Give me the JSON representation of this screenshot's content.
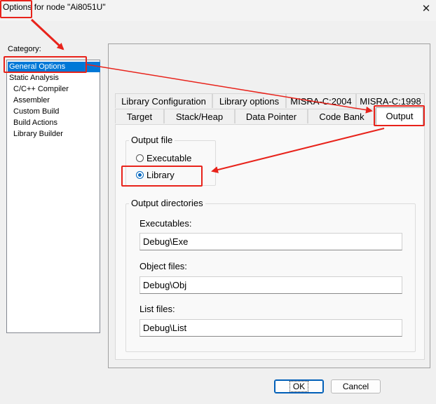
{
  "window": {
    "title": "Options for node \"Ai8051U\""
  },
  "category": {
    "label": "Category:",
    "items": [
      {
        "label": "General Options",
        "selected": true
      },
      {
        "label": "Static Analysis"
      },
      {
        "label": "C/C++ Compiler"
      },
      {
        "label": "Assembler"
      },
      {
        "label": "Custom Build"
      },
      {
        "label": "Build Actions"
      },
      {
        "label": "Library Builder"
      }
    ]
  },
  "tabs": {
    "row_top": [
      "Library Configuration",
      "Library options",
      "MISRA-C:2004",
      "MISRA-C:1998"
    ],
    "row_bottom": [
      "Target",
      "Stack/Heap",
      "Data Pointer",
      "Code Bank",
      "Output"
    ],
    "active": "Output"
  },
  "output_file": {
    "legend": "Output file",
    "options": [
      {
        "label": "Executable",
        "checked": false
      },
      {
        "label": "Library",
        "checked": true
      }
    ]
  },
  "output_directories": {
    "legend": "Output directories",
    "executables_label": "Executables:",
    "executables_value": "Debug\\Exe",
    "object_label": "Object files:",
    "object_value": "Debug\\Obj",
    "list_label": "List files:",
    "list_value": "Debug\\List"
  },
  "buttons": {
    "ok": "OK",
    "cancel": "Cancel"
  },
  "annotation_color": "#e8231b"
}
